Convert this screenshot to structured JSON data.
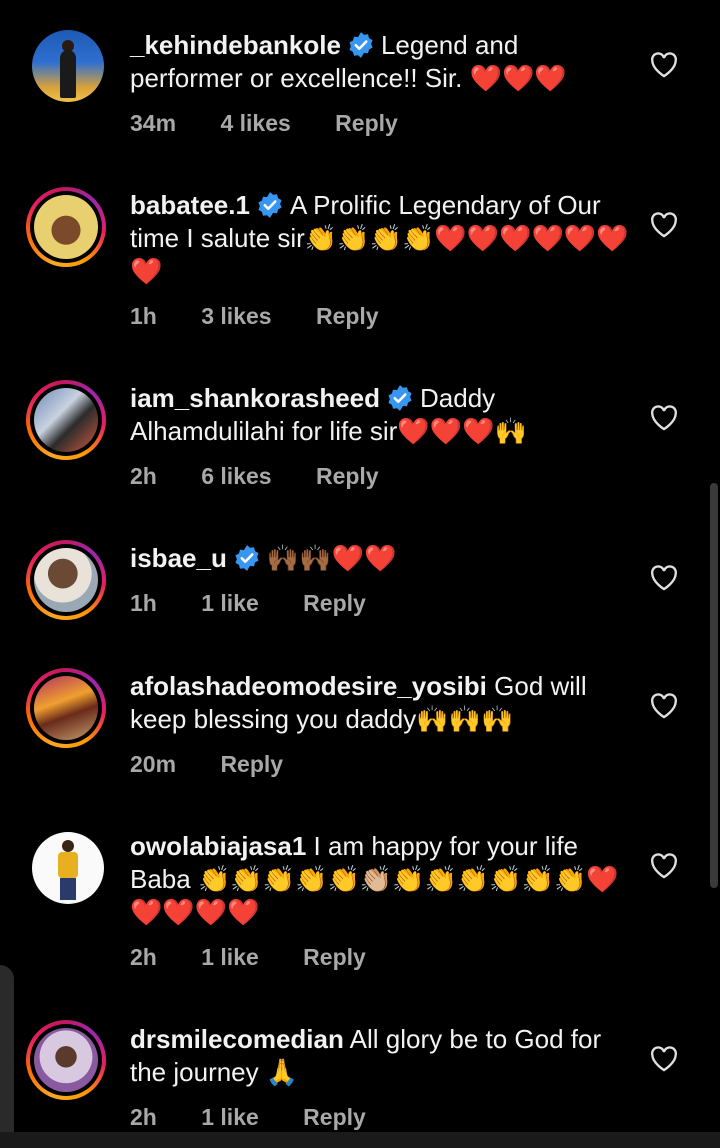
{
  "comments": [
    {
      "username": "_kehindebankole",
      "verified": true,
      "text": "Legend and performer or excellence!! Sir. ❤️❤️❤️",
      "time": "34m",
      "likes": "4 likes",
      "reply": "Reply",
      "avatar_ring": false
    },
    {
      "username": "babatee.1",
      "verified": true,
      "text": "A Prolific Legendary of Our time I salute sir👏👏👏👏❤️❤️❤️❤️❤️❤️❤️",
      "time": "1h",
      "likes": "3 likes",
      "reply": "Reply",
      "avatar_ring": true
    },
    {
      "username": "iam_shankorasheed",
      "verified": true,
      "text": "Daddy Alhamdulilahi for life sir❤️❤️❤️🙌",
      "time": "2h",
      "likes": "6 likes",
      "reply": "Reply",
      "avatar_ring": true
    },
    {
      "username": "isbae_u",
      "verified": true,
      "text": "🙌🏾🙌🏾❤️❤️",
      "time": "1h",
      "likes": "1 like",
      "reply": "Reply",
      "avatar_ring": true
    },
    {
      "username": "afolashadeomodesire_yosibi",
      "verified": false,
      "text": "God will keep blessing you daddy🙌🙌🙌",
      "time": "20m",
      "likes": "",
      "reply": "Reply",
      "avatar_ring": true
    },
    {
      "username": "owolabiajasa1",
      "verified": false,
      "text": "I am happy for your life Baba 👏👏👏👏👏👏🏼👏👏👏👏👏👏❤️❤️❤️❤️❤️",
      "time": "2h",
      "likes": "1 like",
      "reply": "Reply",
      "avatar_ring": false
    },
    {
      "username": "drsmilecomedian",
      "verified": false,
      "text": "All glory be to God for the journey 🙏",
      "time": "2h",
      "likes": "1 like",
      "reply": "Reply",
      "avatar_ring": true
    }
  ],
  "icons": {
    "like": "heart-outline-icon",
    "verified": "verified-badge-icon"
  },
  "colors": {
    "background": "#000000",
    "verified": "#3797f0",
    "meta": "#a8a8a8"
  }
}
